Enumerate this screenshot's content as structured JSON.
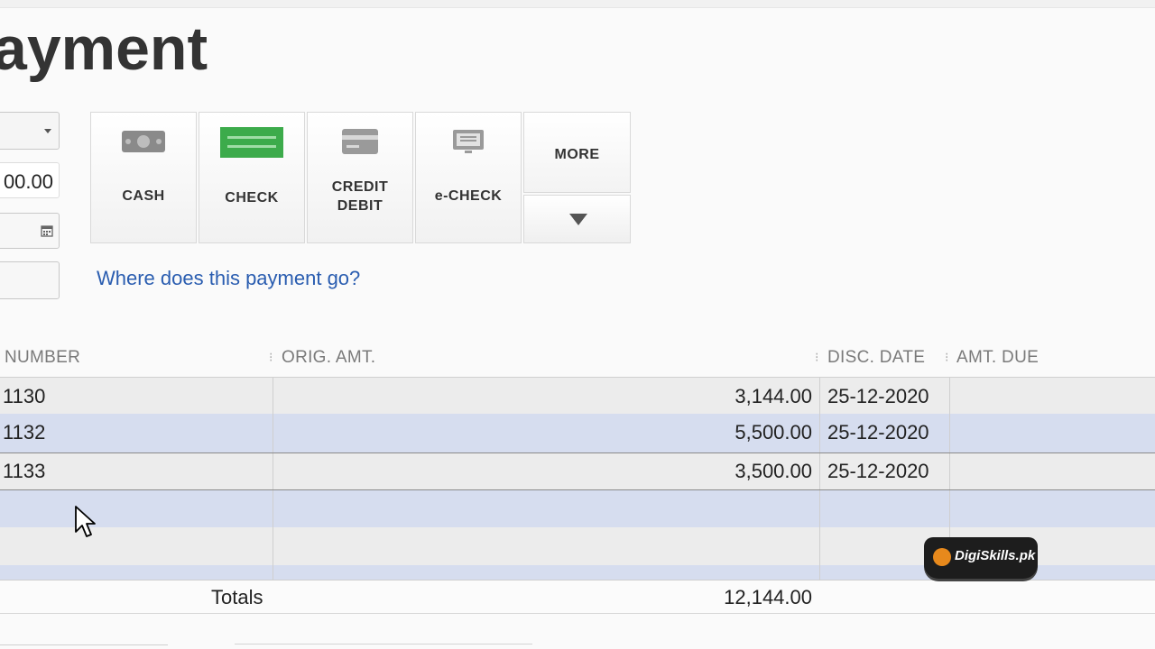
{
  "page": {
    "title": "ayment"
  },
  "form": {
    "amount_value": "00.00"
  },
  "payment_methods": [
    {
      "label": "CASH",
      "icon": "cash-icon"
    },
    {
      "label": "CHECK",
      "icon": "check-icon"
    },
    {
      "label": "CREDIT\nDEBIT",
      "label_line1": "CREDIT",
      "label_line2": "DEBIT",
      "icon": "credit-card-icon"
    },
    {
      "label": "e-CHECK",
      "icon": "monitor-icon"
    }
  ],
  "more": {
    "label": "MORE",
    "icon": "triangle-down-icon"
  },
  "link": {
    "text": "Where does this payment go?"
  },
  "table": {
    "headers": {
      "number": "NUMBER",
      "orig_amt": "ORIG. AMT.",
      "disc_date": "DISC. DATE",
      "amt_due": "AMT. DUE"
    },
    "rows": [
      {
        "number": "1130",
        "orig_amt": "3,144.00",
        "disc_date": "25-12-2020",
        "amt_due": ""
      },
      {
        "number": "1132",
        "orig_amt": "5,500.00",
        "disc_date": "25-12-2020",
        "amt_due": ""
      },
      {
        "number": "1133",
        "orig_amt": "3,500.00",
        "disc_date": "25-12-2020",
        "amt_due": ""
      },
      {
        "number": "",
        "orig_amt": "",
        "disc_date": "",
        "amt_due": ""
      },
      {
        "number": "",
        "orig_amt": "",
        "disc_date": "",
        "amt_due": ""
      }
    ],
    "totals_label": "Totals",
    "totals_value": "12,144.00"
  },
  "watermark": {
    "text": "DigiSkills.pk"
  },
  "colors": {
    "link": "#2a5db0",
    "check_icon": "#3cab4b",
    "row_grey": "#ececec",
    "row_blue": "#d6ddef"
  }
}
